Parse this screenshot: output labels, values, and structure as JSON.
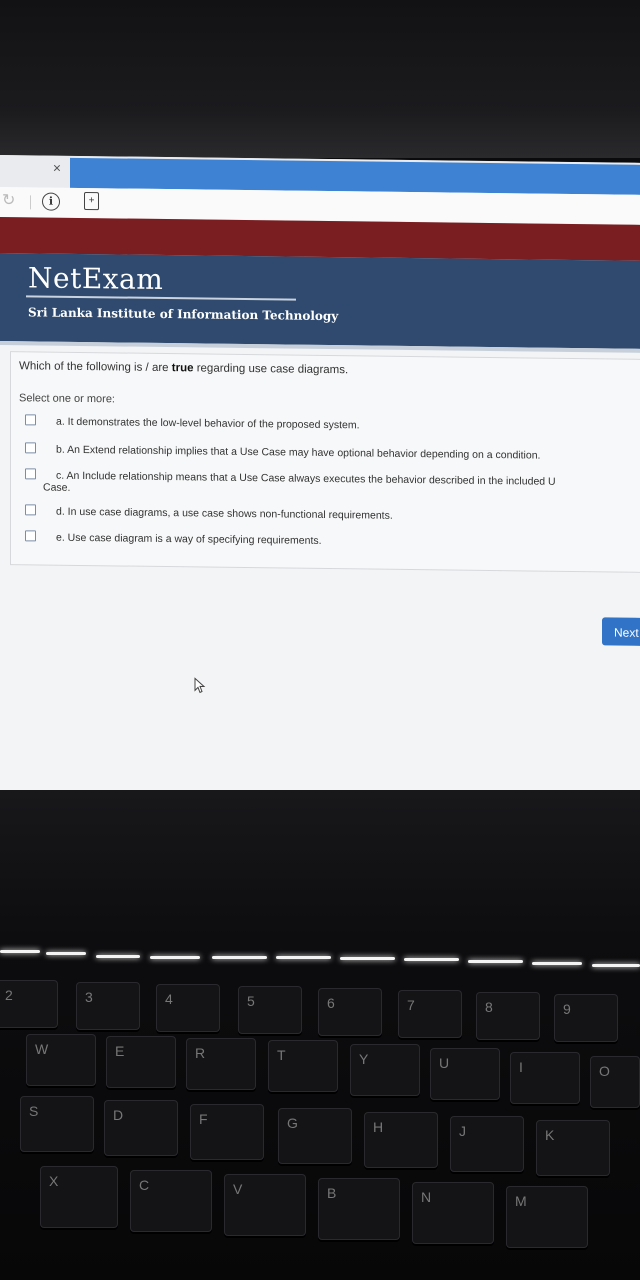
{
  "browser": {
    "tab_close": "×",
    "reload_glyph": "↻"
  },
  "header": {
    "brand": "NetExam",
    "subbrand": "Sri Lanka Institute of Information Technology"
  },
  "question": {
    "text_before": "Which of the following is / are ",
    "text_bold": "true",
    "text_after": " regarding use case diagrams.",
    "prompt": "Select one or more:",
    "options": [
      {
        "label": "a. It demonstrates the low-level behavior of the proposed system."
      },
      {
        "label": "b. An Extend relationship implies that a Use Case may have optional behavior depending on a condition."
      },
      {
        "label": "c. An Include relationship means that a Use Case always executes the behavior described in the included U",
        "continuation": "Case."
      },
      {
        "label": "d. In use case diagrams, a use case shows non-functional requirements."
      },
      {
        "label": "e. Use case diagram is a way of specifying requirements."
      }
    ]
  },
  "navigation": {
    "next_label": "Next"
  },
  "keyboard": {
    "row1": [
      "2",
      "3",
      "4",
      "5",
      "6",
      "7",
      "8",
      "9"
    ],
    "row1_shift": [
      "@",
      "#",
      "$",
      "%",
      "^",
      "&",
      "*",
      "("
    ],
    "row2": [
      "W",
      "E",
      "R",
      "T",
      "Y",
      "U",
      "I",
      "O"
    ],
    "row3": [
      "S",
      "D",
      "F",
      "G",
      "H",
      "J",
      "K"
    ],
    "row4": [
      "X",
      "C",
      "V",
      "B",
      "N",
      "M"
    ]
  }
}
